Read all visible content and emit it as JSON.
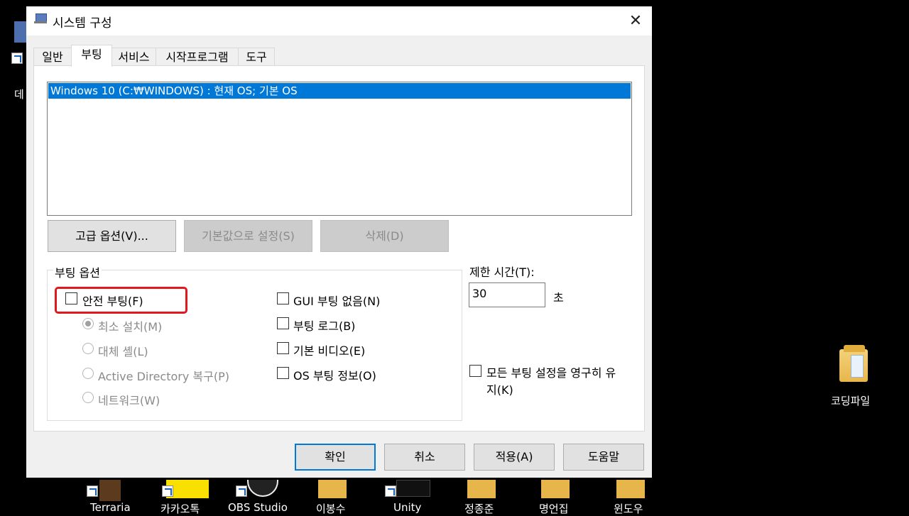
{
  "desktop": {
    "left_partial_label": "데",
    "right_folder_label": "코딩파일",
    "taskbar_icons": [
      {
        "label": "Terraria"
      },
      {
        "label": "카카오톡"
      },
      {
        "label": "OBS Studio"
      },
      {
        "label": "이봉수"
      },
      {
        "label": "Unity"
      },
      {
        "label": "정종준"
      },
      {
        "label": "명언집"
      },
      {
        "label": "윈도우"
      }
    ]
  },
  "dialog": {
    "title": "시스템 구성",
    "close_glyph": "✕",
    "tabs": [
      "일반",
      "부팅",
      "서비스",
      "시작프로그램",
      "도구"
    ],
    "active_tab": "부팅",
    "os_list": [
      "Windows 10 (C:₩WINDOWS) : 현재 OS; 기본 OS"
    ],
    "buttons_row": {
      "advanced": "고급 옵션(V)...",
      "set_default": "기본값으로 설정(S)",
      "delete": "삭제(D)"
    },
    "boot_options": {
      "legend": "부팅 옵션",
      "safe_boot": "안전 부팅(F)",
      "safe_boot_checked": false,
      "radio_minimal": "최소 설치(M)",
      "radio_alt_shell": "대체 셸(L)",
      "radio_ad_repair": "Active Directory 복구(P)",
      "radio_network": "네트워크(W)",
      "no_gui": "GUI 부팅 없음(N)",
      "boot_log": "부팅 로그(B)",
      "base_video": "기본 비디오(E)",
      "os_boot_info": "OS 부팅 정보(O)"
    },
    "timeout": {
      "label": "제한 시간(T):",
      "value": "30",
      "unit": "초"
    },
    "permanent": {
      "line1": "모든 부팅 설정을 영구히 유",
      "line2": "지(K)"
    },
    "footer": {
      "ok": "확인",
      "cancel": "취소",
      "apply": "적용(A)",
      "help": "도움말"
    },
    "colors": {
      "selection": "#0078d7",
      "highlight_border": "#e0191f"
    }
  }
}
